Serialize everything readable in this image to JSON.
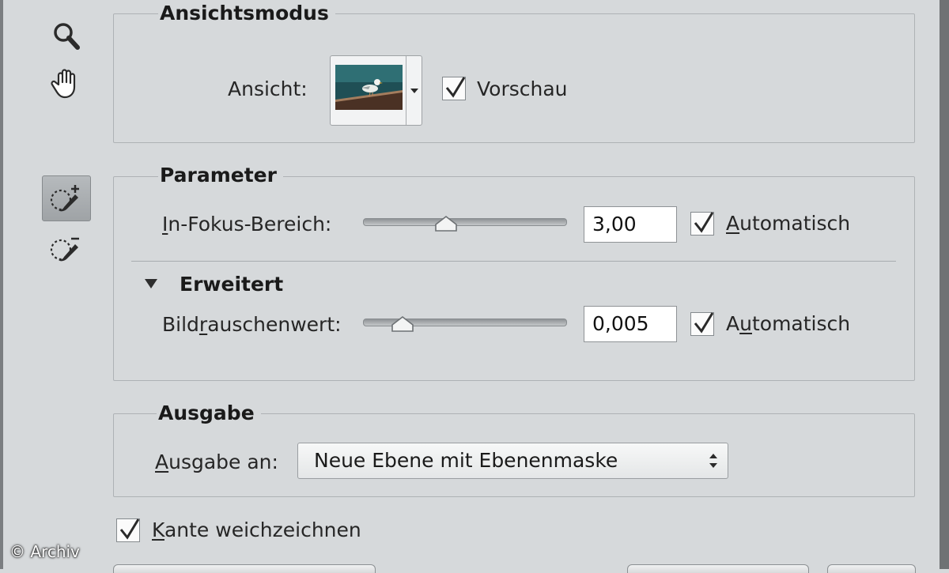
{
  "tools": {
    "zoom": "zoom-icon",
    "hand": "hand-icon",
    "focus_add": "focus-area-add-icon",
    "focus_subtract": "focus-area-subtract-icon"
  },
  "view_mode": {
    "title": "Ansichtsmodus",
    "view_label": "Ansicht:",
    "preview_checked": true,
    "preview_label": "Vorschau"
  },
  "parameter": {
    "title": "Parameter",
    "focus_label_accel": "I",
    "focus_label_rest": "n-Fokus-Bereich:",
    "focus_value": "3,00",
    "focus_auto_checked": true,
    "focus_auto_accel": "A",
    "focus_auto_rest": "utomatisch",
    "advanced_title": "Erweitert",
    "noise_label_pre": "Bild",
    "noise_label_accel": "r",
    "noise_label_post": "auschenwert:",
    "noise_value": "0,005",
    "noise_auto_checked": true,
    "noise_auto_pre": "A",
    "noise_auto_accel": "u",
    "noise_auto_post": "tomatisch"
  },
  "output": {
    "title": "Ausgabe",
    "to_label_accel": "A",
    "to_label_rest": "usgabe an:",
    "selected": "Neue Ebene mit Ebenenmaske"
  },
  "soften": {
    "checked": true,
    "label_accel": "K",
    "label_rest": "ante weichzeichnen"
  },
  "watermark": "© Archiv",
  "colors": {
    "panel_bg": "#d6d9db",
    "frame_border": "#aeb2b5",
    "checkmark": "#2a2a2a"
  }
}
